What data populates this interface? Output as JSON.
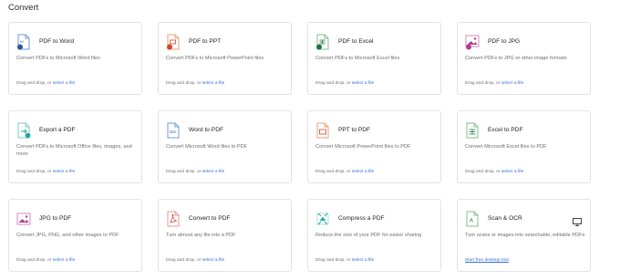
{
  "section_title": "Convert",
  "drop_text": "Drag and drop, or ",
  "select_link": "select a file",
  "cards": [
    {
      "title": "PDF to Word",
      "desc": "Convert PDFs to Microsoft Word files",
      "icon": "word-file-icon",
      "accent": "#2b5797"
    },
    {
      "title": "PDF to PPT",
      "desc": "Convert PDFs to Microsoft PowerPoint files",
      "icon": "ppt-file-icon",
      "accent": "#d24726"
    },
    {
      "title": "PDF to Excel",
      "desc": "Convert PDFs to Microsoft Excel files",
      "icon": "excel-file-icon",
      "accent": "#1e7145"
    },
    {
      "title": "PDF to JPG",
      "desc": "Convert PDFs to JPG or other image formats",
      "icon": "image-file-icon",
      "accent": "#b23c91"
    },
    {
      "title": "Export a PDF",
      "desc": "Convert PDFs to Microsoft Office files, images, and more",
      "icon": "export-pdf-icon",
      "accent": "#1aa3a3"
    },
    {
      "title": "Word to PDF",
      "desc": "Convert Microsoft Word files to PDF",
      "icon": "word-document-icon",
      "accent": "#2b5797"
    },
    {
      "title": "PPT to PDF",
      "desc": "Convert Microsoft PowerPoint files to PDF",
      "icon": "ppt-document-icon",
      "accent": "#d24726"
    },
    {
      "title": "Excel to PDF",
      "desc": "Convert Microsoft Excel files to PDF",
      "icon": "excel-document-icon",
      "accent": "#1e7145"
    },
    {
      "title": "JPG to PDF",
      "desc": "Convert JPG, PNG, and other images to PDF",
      "icon": "jpg-image-icon",
      "accent": "#b23c91"
    },
    {
      "title": "Convert to PDF",
      "desc": "Turn almost any file into a PDF",
      "icon": "create-pdf-icon",
      "accent": "#d4372c"
    },
    {
      "title": "Compress a PDF",
      "desc": "Reduce the size of your PDF for easier sharing",
      "icon": "compress-pdf-icon",
      "accent": "#1aa3a3"
    },
    {
      "title": "Scan & OCR",
      "desc": "Turn scans or images into searchable, editable PDFs",
      "icon": "scan-ocr-icon",
      "accent": "#1e7145",
      "trial": "Start free desktop trial",
      "extra_icon": "monitor-icon"
    }
  ]
}
